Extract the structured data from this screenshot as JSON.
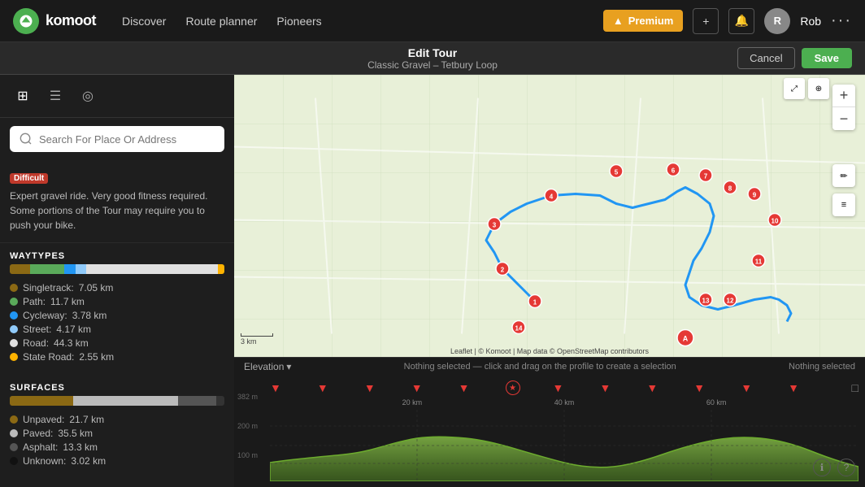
{
  "app": {
    "logo_text": "komoot"
  },
  "topnav": {
    "links": [
      {
        "label": "Discover",
        "id": "discover"
      },
      {
        "label": "Route planner",
        "id": "route-planner"
      },
      {
        "label": "Pioneers",
        "id": "pioneers"
      }
    ],
    "premium_label": "Premium",
    "add_icon": "+",
    "notification_icon": "🔔",
    "username": "Rob",
    "more_icon": "···"
  },
  "edit_tour_bar": {
    "title": "Edit Tour",
    "subtitle": "Classic Gravel – Tetbury Loop",
    "cancel_label": "Cancel",
    "save_label": "Save"
  },
  "sidebar": {
    "icons": [
      {
        "id": "map-icon",
        "symbol": "⊞",
        "active": true
      },
      {
        "id": "list-icon",
        "symbol": "☰",
        "active": false
      },
      {
        "id": "eye-icon",
        "symbol": "👁",
        "active": false
      }
    ],
    "search_placeholder": "Search For Place Or Address",
    "difficulty": "Difficult",
    "description": "Expert gravel ride. Very good fitness required. Some portions of the Tour may require you to push your bike.",
    "waytypes_title": "WAYTYPES",
    "waytypes": [
      {
        "label": "Singletrack:",
        "value": "7.05 km",
        "color": "#8B6914",
        "pct": 9
      },
      {
        "label": "Path:",
        "value": "11.7 km",
        "color": "#5aaa5a",
        "pct": 15
      },
      {
        "label": "Cycleway:",
        "value": "3.78 km",
        "color": "#2196f3",
        "pct": 5
      },
      {
        "label": "Street:",
        "value": "4.17 km",
        "color": "#90caf9",
        "pct": 5
      },
      {
        "label": "Road:",
        "value": "44.3 km",
        "color": "#e0e0e0",
        "pct": 58
      },
      {
        "label": "State Road:",
        "value": "2.55 km",
        "color": "#ffb300",
        "pct": 3
      }
    ],
    "waytype_bar": [
      {
        "color": "#8B6914",
        "flex": 9
      },
      {
        "color": "#5aaa5a",
        "flex": 15
      },
      {
        "color": "#2196f3",
        "flex": 5
      },
      {
        "color": "#90caf9",
        "flex": 5
      },
      {
        "color": "#e0e0e0",
        "flex": 58
      },
      {
        "color": "#ffb300",
        "flex": 3
      }
    ],
    "surfaces_title": "SURFACES",
    "surfaces": [
      {
        "label": "Unpaved:",
        "value": "21.7 km",
        "color": "#8B6914"
      },
      {
        "label": "Paved:",
        "value": "35.5 km",
        "color": "#bbb"
      },
      {
        "label": "Asphalt:",
        "value": "13.3 km",
        "color": "#555"
      },
      {
        "label": "Unknown:",
        "value": "3.02 km",
        "color": "#111"
      }
    ],
    "surface_bar": [
      {
        "color": "#8B6914",
        "flex": 30
      },
      {
        "color": "#bbb",
        "flex": 49
      },
      {
        "color": "#555",
        "flex": 18
      },
      {
        "color": "#333",
        "flex": 4
      }
    ]
  },
  "elevation": {
    "label": "Elevation",
    "hint_left": "Nothing selected — click and drag on the profile to create a selection",
    "hint_right": "Nothing selected",
    "distance_labels": [
      "20 km",
      "40 km",
      "60 km"
    ],
    "y_labels": [
      "382 m",
      "200 m",
      "100 m"
    ],
    "attribution": "Leaflet | © Komoot | Map data © OpenStreetMap contributors"
  },
  "map": {
    "zoom_in": "+",
    "zoom_out": "−",
    "scale_label": "3 km"
  }
}
